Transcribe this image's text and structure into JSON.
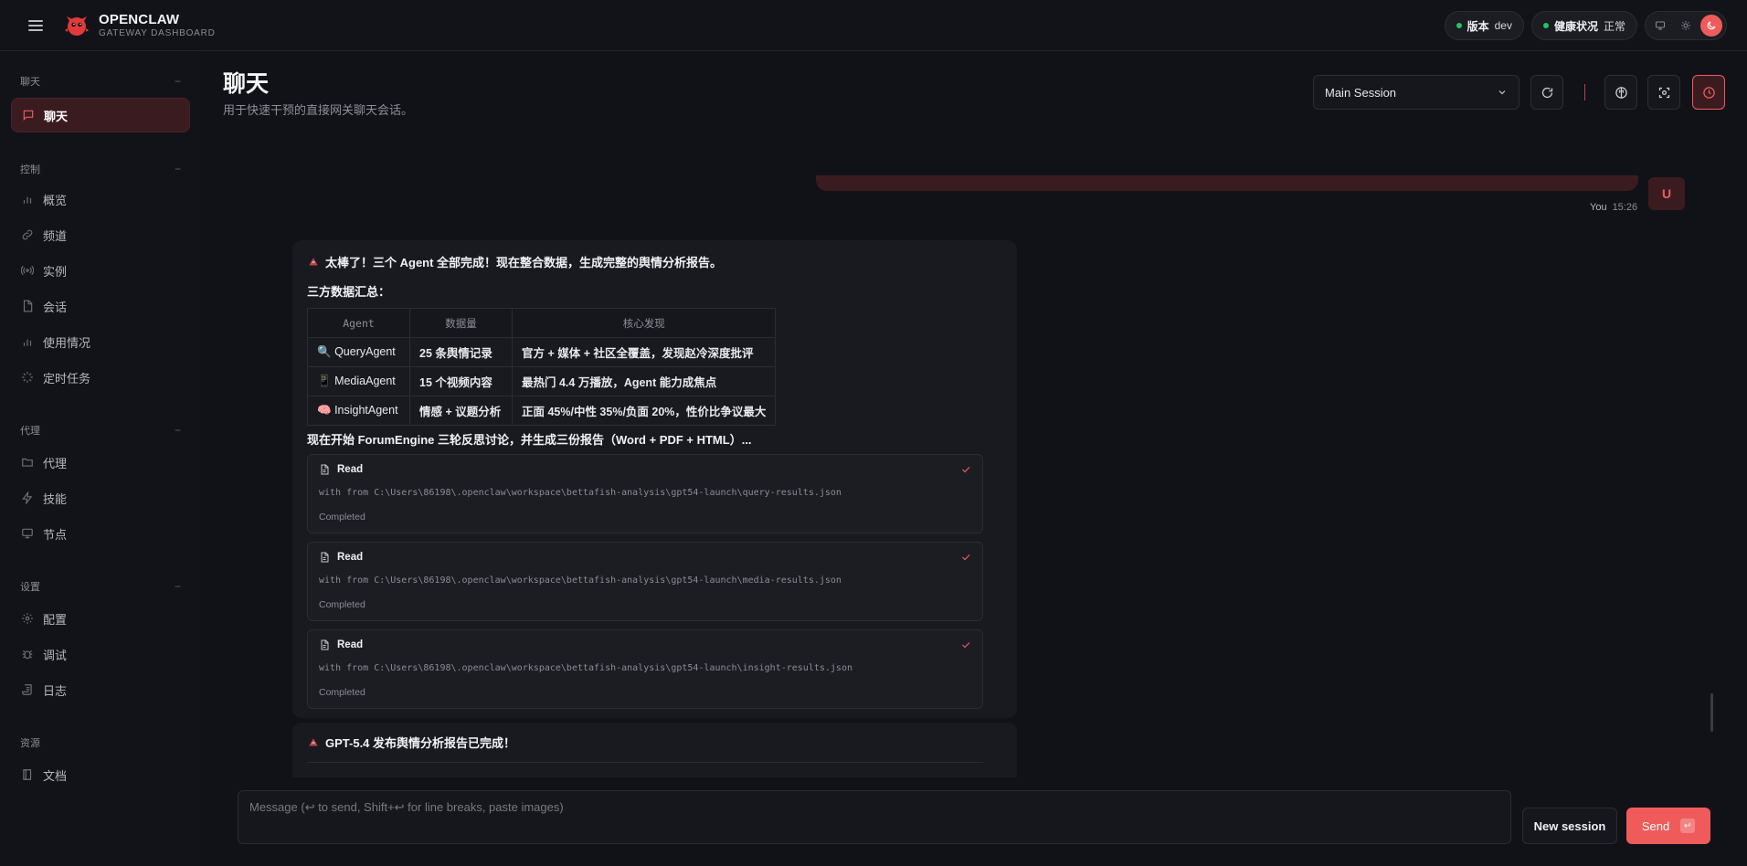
{
  "brand": {
    "name": "OPENCLAW",
    "subtitle": "GATEWAY DASHBOARD"
  },
  "topbar": {
    "version_label": "版本",
    "version_value": "dev",
    "health_label": "健康状况",
    "health_value": "正常"
  },
  "sidebar": {
    "groups": [
      {
        "title": "聊天",
        "items": [
          "聊天"
        ]
      },
      {
        "title": "控制",
        "items": [
          "概览",
          "频道",
          "实例",
          "会话",
          "使用情况",
          "定时任务"
        ]
      },
      {
        "title": "代理",
        "items": [
          "代理",
          "技能",
          "节点"
        ]
      },
      {
        "title": "设置",
        "items": [
          "配置",
          "调试",
          "日志"
        ]
      },
      {
        "title": "资源",
        "items": [
          "文档"
        ]
      }
    ]
  },
  "header": {
    "title": "聊天",
    "subtitle": "用于快速干预的直接网关聊天会话。",
    "session": "Main Session"
  },
  "user_message": {
    "avatar": "U",
    "sender": "You",
    "time": "15:26"
  },
  "assistant": {
    "line1": "太棒了！三个 Agent 全部完成！现在整合数据，生成完整的舆情分析报告。",
    "line2": "三方数据汇总：",
    "table": {
      "headers": [
        "Agent",
        "数据量",
        "核心发现"
      ],
      "rows": [
        {
          "agent": "QueryAgent",
          "icon": "🔍",
          "count": "25 条舆情记录",
          "finding": "官方 + 媒体 + 社区全覆盖，发现赵冷深度批评"
        },
        {
          "agent": "MediaAgent",
          "icon": "📱",
          "count": "15 个视频内容",
          "finding": "最热门 4.4 万播放，Agent 能力成焦点"
        },
        {
          "agent": "InsightAgent",
          "icon": "🧠",
          "count": "情感 + 议题分析",
          "finding": "正面 45%/中性 35%/负面 20%，性价比争议最大"
        }
      ]
    },
    "line3": "现在开始 ForumEngine 三轮反思讨论，并生成三份报告（Word + PDF + HTML）...",
    "tools": [
      {
        "name": "Read",
        "path": "with from C:\\Users\\86198\\.openclaw\\workspace\\bettafish-analysis\\gpt54-launch\\query-results.json",
        "status": "Completed"
      },
      {
        "name": "Read",
        "path": "with from C:\\Users\\86198\\.openclaw\\workspace\\bettafish-analysis\\gpt54-launch\\media-results.json",
        "status": "Completed"
      },
      {
        "name": "Read",
        "path": "with from C:\\Users\\86198\\.openclaw\\workspace\\bettafish-analysis\\gpt54-launch\\insight-results.json",
        "status": "Completed"
      }
    ]
  },
  "assistant2": {
    "title": "GPT-5.4 发布舆情分析报告已完成！"
  },
  "composer": {
    "placeholder": "Message (↩ to send, Shift+↩ for line breaks, paste images)",
    "new_session": "New session",
    "send": "Send",
    "send_kbd": "↵"
  },
  "colors": {
    "accent": "#ef5b5b",
    "ok": "#22c55e",
    "bg": "#111217"
  }
}
